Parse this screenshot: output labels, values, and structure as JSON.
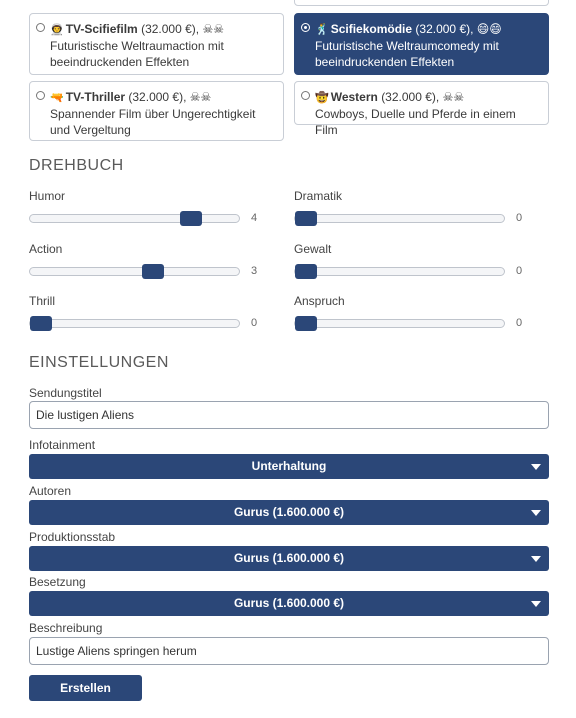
{
  "genres": [
    {
      "name": "TV-Scifiefilm",
      "price": "(32.000 €),",
      "rating": "☠☠",
      "desc": "Futuristische Weltraumaction mit beeindruckenden Effekten",
      "icon": "👨‍🚀",
      "selected": false
    },
    {
      "name": "Scifiekomödie",
      "price": "(32.000 €),",
      "rating": "😄😄",
      "desc": "Futuristische Weltraumcomedy mit beeindruckenden Effekten",
      "icon": "🕺",
      "selected": true
    },
    {
      "name": "TV-Thriller",
      "price": "(32.000 €),",
      "rating": "☠☠",
      "desc": "Spannender Film über Ungerechtigkeit und Vergeltung",
      "icon": "🔫",
      "selected": false
    },
    {
      "name": "Western",
      "price": "(32.000 €),",
      "rating": "☠☠",
      "desc": "Cowboys, Duelle und Pferde in einem Film",
      "icon": "🤠",
      "selected": false
    }
  ],
  "drehbuch": {
    "title": "DREHBUCH",
    "sliders": [
      {
        "label": "Humor",
        "value": 4,
        "display": "4",
        "max": 5
      },
      {
        "label": "Dramatik",
        "value": 0,
        "display": "0",
        "max": 5
      },
      {
        "label": "Action",
        "value": 3,
        "display": "3",
        "max": 5
      },
      {
        "label": "Gewalt",
        "value": 0,
        "display": "0",
        "max": 5
      },
      {
        "label": "Thrill",
        "value": 0,
        "display": "0",
        "max": 5
      },
      {
        "label": "Anspruch",
        "value": 0,
        "display": "0",
        "max": 5
      }
    ]
  },
  "einstellungen": {
    "title": "EINSTELLUNGEN",
    "sendungstitel_label": "Sendungstitel",
    "sendungstitel_value": "Die lustigen Aliens",
    "infotainment_label": "Infotainment",
    "infotainment_value": "Unterhaltung",
    "autoren_label": "Autoren",
    "autoren_value": "Gurus (1.600.000 €)",
    "produktionsstab_label": "Produktionsstab",
    "produktionsstab_value": "Gurus (1.600.000 €)",
    "besetzung_label": "Besetzung",
    "besetzung_value": "Gurus (1.600.000 €)",
    "beschreibung_label": "Beschreibung",
    "beschreibung_value": "Lustige Aliens springen herum",
    "submit_label": "Erstellen"
  },
  "colors": {
    "accent": "#2b4778"
  }
}
